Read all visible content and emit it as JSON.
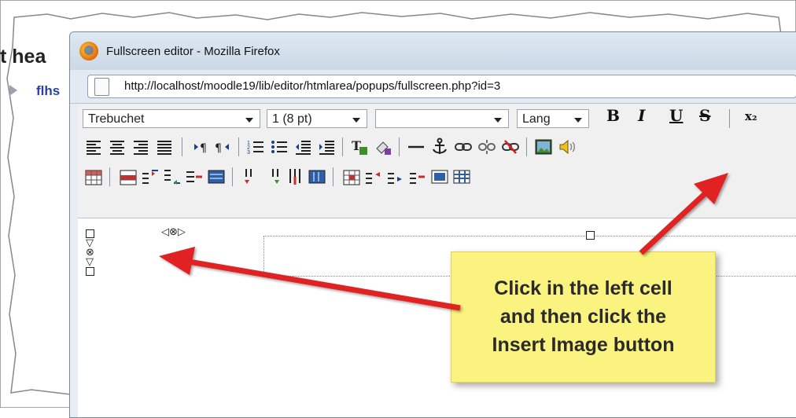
{
  "background_page": {
    "heading_fragment": "t hea",
    "link_fragment": "flhs"
  },
  "window": {
    "title": "Fullscreen editor - Mozilla Firefox",
    "url": "http://localhost/moodle19/lib/editor/htmlarea/popups/fullscreen.php?id=3"
  },
  "toolbar": {
    "font_family": "Trebuchet",
    "font_size": "1 (8 pt)",
    "format": "",
    "lang": "Lang",
    "bold": "B",
    "italic": "I",
    "underline": "U",
    "strikethrough": "S",
    "subscript": "x₂"
  },
  "callout": {
    "text": "Click in the left cell\nand then click the\nInsert Image button"
  },
  "colors": {
    "arrow": "#e02020",
    "callout_bg": "#fbf37f",
    "window_chrome": "#dfe8f2"
  }
}
